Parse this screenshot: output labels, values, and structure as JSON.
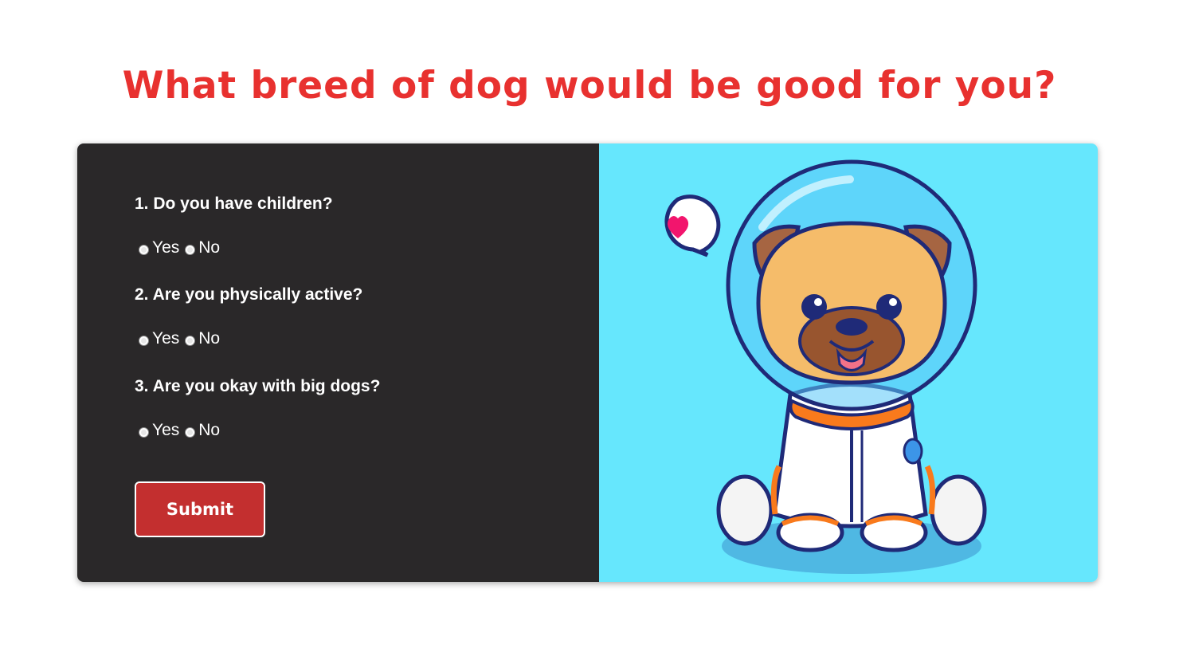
{
  "page": {
    "title": "What breed of dog would be good for you?"
  },
  "form": {
    "questions": [
      {
        "label": "1. Do you have children?",
        "options": [
          "Yes",
          "No"
        ]
      },
      {
        "label": "2. Are you physically active?",
        "options": [
          "Yes",
          "No"
        ]
      },
      {
        "label": "3. Are you okay with big dogs?",
        "options": [
          "Yes",
          "No"
        ]
      }
    ],
    "submit_label": "Submit"
  },
  "illustration": {
    "subject": "pug-astronaut",
    "speech_icon": "heart-icon"
  },
  "colors": {
    "title": "#e8312f",
    "form_panel_bg": "#2a2829",
    "image_panel_bg": "#66e7fd",
    "submit_bg": "#c32f2f"
  }
}
